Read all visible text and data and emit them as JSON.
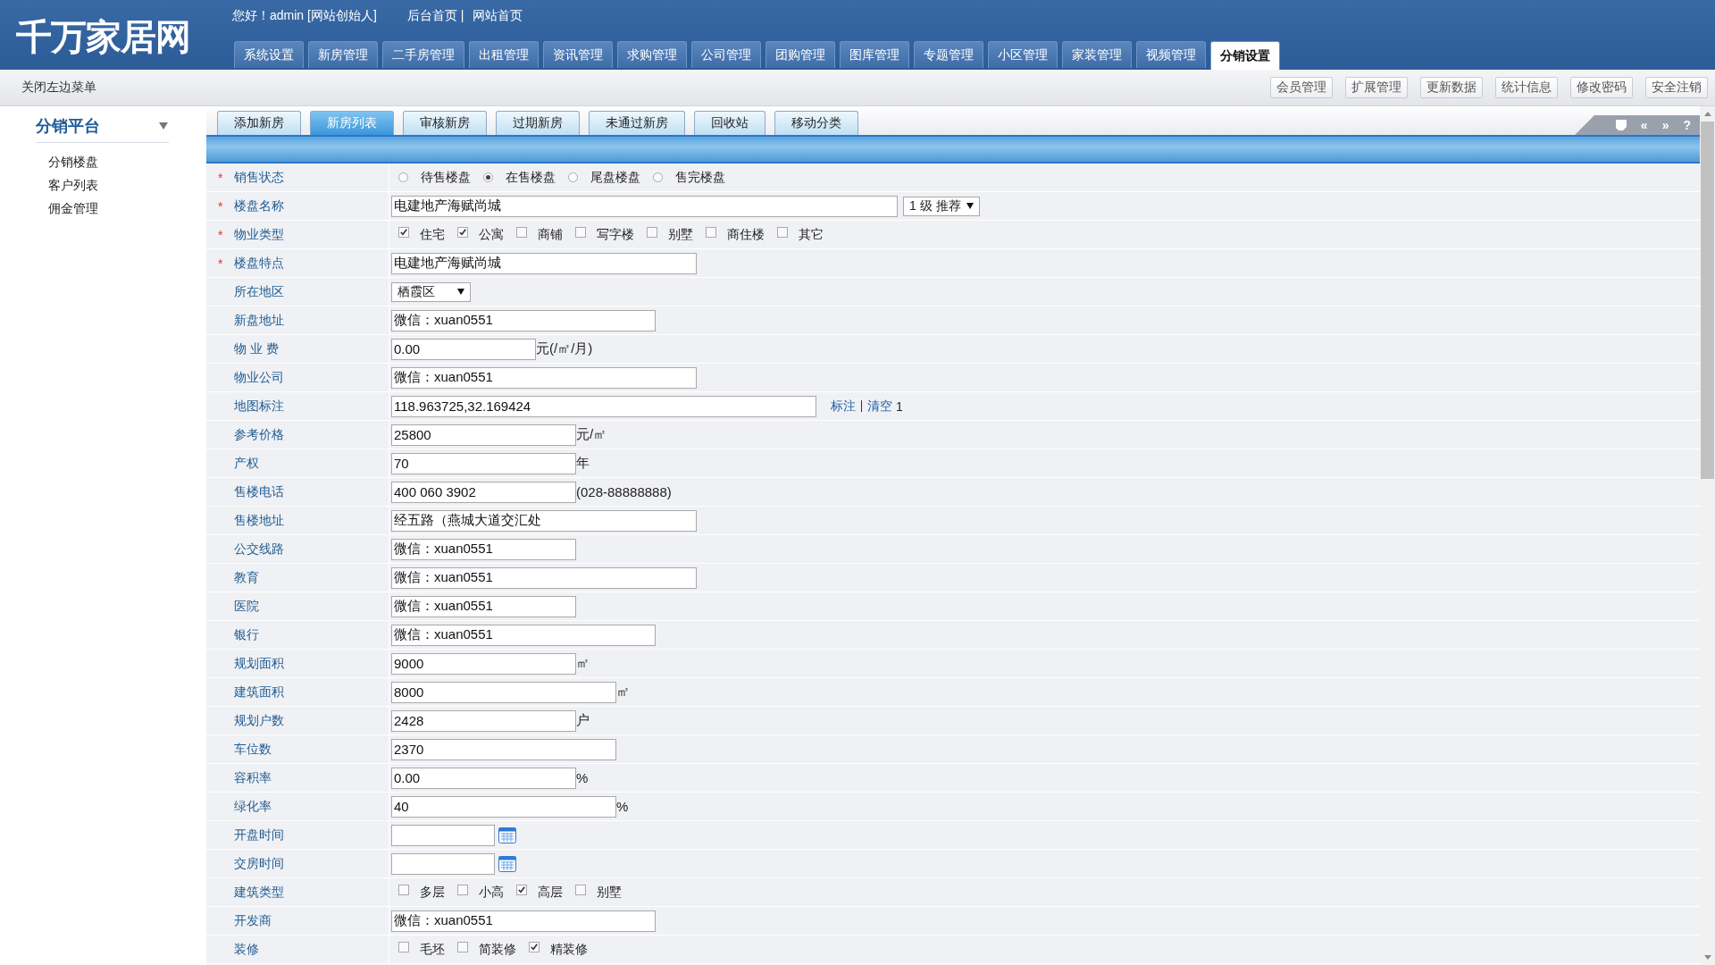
{
  "header": {
    "logo": "千万家居网",
    "greeting": "您好！admin [网站创始人]",
    "links": [
      "后台首页 |",
      "网站首页"
    ],
    "nav": [
      {
        "label": "系统设置",
        "selected": false
      },
      {
        "label": "新房管理",
        "selected": false
      },
      {
        "label": "二手房管理",
        "selected": false
      },
      {
        "label": "出租管理",
        "selected": false
      },
      {
        "label": "资讯管理",
        "selected": false
      },
      {
        "label": "求购管理",
        "selected": false
      },
      {
        "label": "公司管理",
        "selected": false
      },
      {
        "label": "团购管理",
        "selected": false
      },
      {
        "label": "图库管理",
        "selected": false
      },
      {
        "label": "专题管理",
        "selected": false
      },
      {
        "label": "小区管理",
        "selected": false
      },
      {
        "label": "家装管理",
        "selected": false
      },
      {
        "label": "视频管理",
        "selected": false
      },
      {
        "label": "分销设置",
        "selected": true
      }
    ]
  },
  "subbar": {
    "toggle": "关闭左边菜单",
    "buttons": [
      "会员管理",
      "扩展管理",
      "更新数据",
      "统计信息",
      "修改密码",
      "安全注销"
    ]
  },
  "sidebar": {
    "title": "分销平台",
    "expanded": true,
    "items": [
      "分销楼盘",
      "客户列表",
      "佣金管理"
    ]
  },
  "tabs": [
    {
      "label": "添加新房",
      "selected": false
    },
    {
      "label": "新房列表",
      "selected": true
    },
    {
      "label": "审核新房",
      "selected": false
    },
    {
      "label": "过期新房",
      "selected": false
    },
    {
      "label": "未通过新房",
      "selected": false
    },
    {
      "label": "回收站",
      "selected": false
    },
    {
      "label": "移动分类",
      "selected": false
    }
  ],
  "toolbar_icons": [
    "«",
    "»",
    "?"
  ],
  "fields": [
    {
      "label": "销售状态",
      "mark": "*",
      "kind": "radio",
      "options": [
        {
          "label": "待售楼盘",
          "selected": false
        },
        {
          "label": "在售楼盘",
          "selected": true
        },
        {
          "label": "尾盘楼盘",
          "selected": false
        },
        {
          "label": "售完楼盘",
          "selected": false
        }
      ]
    },
    {
      "label": "楼盘名称",
      "mark": "*",
      "kind": "text",
      "value": "电建地产海赋尚城",
      "select": "1 级 推荐"
    },
    {
      "label": "物业类型",
      "mark": "*",
      "kind": "checkbox",
      "options": [
        {
          "label": "住宅",
          "checked": true
        },
        {
          "label": "公寓",
          "checked": true
        },
        {
          "label": "商铺",
          "checked": false
        },
        {
          "label": "写字楼",
          "checked": false
        },
        {
          "label": "别墅",
          "checked": false
        },
        {
          "label": "商住楼",
          "checked": false
        },
        {
          "label": "其它",
          "checked": false
        }
      ]
    },
    {
      "label": "楼盘特点",
      "mark": "*",
      "kind": "text",
      "value": "电建地产海赋尚城"
    },
    {
      "label": "所在地区",
      "kind": "select",
      "value": "栖霞区"
    },
    {
      "label": "新盘地址",
      "kind": "text",
      "value": "微信：xuan0551"
    },
    {
      "label": "物 业 费",
      "kind": "text",
      "value": "0.00",
      "suffix": "元(/㎡/月)"
    },
    {
      "label": "物业公司",
      "kind": "text",
      "value": "微信：xuan0551"
    },
    {
      "label": "地图标注",
      "kind": "text",
      "value": "118.963725,32.169424",
      "links": [
        "标注",
        "清空"
      ],
      "note": "1"
    },
    {
      "label": "参考价格",
      "kind": "text",
      "value": "25800",
      "suffix": "元/㎡"
    },
    {
      "label": "产权",
      "kind": "text",
      "value": "70",
      "suffix": "年"
    },
    {
      "label": "售楼电话",
      "kind": "text",
      "value": "400 060 3902",
      "suffix": "(028-88888888)"
    },
    {
      "label": "售楼地址",
      "kind": "text",
      "value": "经五路（燕城大道交汇处"
    },
    {
      "label": "公交线路",
      "kind": "text",
      "value": "微信：xuan0551"
    },
    {
      "label": "教育",
      "kind": "text",
      "value": "微信：xuan0551"
    },
    {
      "label": "医院",
      "kind": "text",
      "value": "微信：xuan0551"
    },
    {
      "label": "银行",
      "kind": "text",
      "value": "微信：xuan0551"
    },
    {
      "label": "规划面积",
      "kind": "text",
      "value": "9000",
      "suffix": "㎡"
    },
    {
      "label": "建筑面积",
      "kind": "text",
      "value": "8000",
      "suffix": "㎡"
    },
    {
      "label": "规划户数",
      "kind": "text",
      "value": "2428",
      "suffix": "户"
    },
    {
      "label": "车位数",
      "kind": "text",
      "value": "2370"
    },
    {
      "label": "容积率",
      "kind": "text",
      "value": "0.00",
      "suffix": "%"
    },
    {
      "label": "绿化率",
      "kind": "text",
      "value": "40",
      "suffix": "%"
    },
    {
      "label": "开盘时间",
      "kind": "date"
    },
    {
      "label": "交房时间",
      "kind": "date"
    },
    {
      "label": "建筑类型",
      "kind": "checkbox",
      "options": [
        {
          "label": "多层",
          "checked": false
        },
        {
          "label": "小高",
          "checked": false
        },
        {
          "label": "高层",
          "checked": true
        },
        {
          "label": "别墅",
          "checked": false
        }
      ]
    },
    {
      "label": "开发商",
      "kind": "text",
      "value": "微信：xuan0551"
    },
    {
      "label": "装修",
      "kind": "checkbox",
      "options": [
        {
          "label": "毛坯",
          "checked": false
        },
        {
          "label": "简装修",
          "checked": false
        },
        {
          "label": "精装修",
          "checked": true
        }
      ]
    }
  ]
}
